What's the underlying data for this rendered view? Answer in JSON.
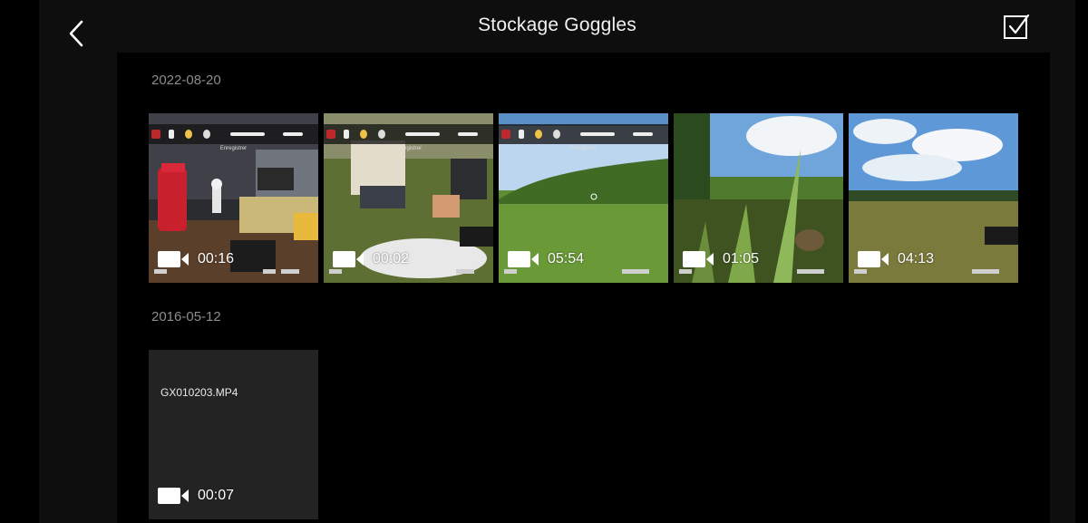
{
  "header": {
    "title": "Stockage Goggles",
    "back_icon": "chevron-left-icon",
    "select_icon": "checkbox-checked-icon"
  },
  "groups": [
    {
      "date": "2022-08-20",
      "items": [
        {
          "duration": "00:16",
          "selected": true,
          "osd_label": "Enregistrer"
        },
        {
          "duration": "00:02",
          "selected": false,
          "osd_label": "Enregistrer"
        },
        {
          "duration": "05:54",
          "selected": false,
          "osd_label": "Enregistrer"
        },
        {
          "duration": "01:05",
          "selected": false
        },
        {
          "duration": "04:13",
          "selected": false
        }
      ]
    },
    {
      "date": "2016-05-12",
      "items": [
        {
          "filename": "GX010203.MP4",
          "duration": "00:07"
        }
      ]
    }
  ],
  "colors": {
    "selection": "#d8b436",
    "background": "#000000",
    "tile": "#232323"
  }
}
